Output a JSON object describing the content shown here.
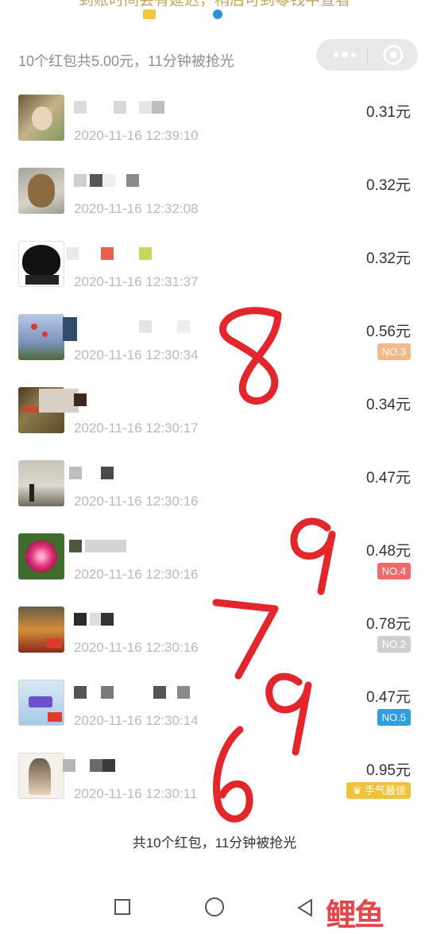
{
  "notice": {
    "text": "到账时间会有延迟，稍后可到零钱中查看"
  },
  "summary": {
    "text": "10个红包共5.00元，11分钟被抢光"
  },
  "capsule": {
    "more_icon": "more-dots-icon",
    "close_icon": "target-icon"
  },
  "records": [
    {
      "time": "2020-11-16 12:39:10",
      "amount": "0.31元",
      "badge": ""
    },
    {
      "time": "2020-11-16 12:32:08",
      "amount": "0.32元",
      "badge": ""
    },
    {
      "time": "2020-11-16 12:31:37",
      "amount": "0.32元",
      "badge": ""
    },
    {
      "time": "2020-11-16 12:30:34",
      "amount": "0.56元",
      "badge": "NO.3"
    },
    {
      "time": "2020-11-16 12:30:17",
      "amount": "0.34元",
      "badge": ""
    },
    {
      "time": "2020-11-16 12:30:16",
      "amount": "0.47元",
      "badge": ""
    },
    {
      "time": "2020-11-16 12:30:16",
      "amount": "0.48元",
      "badge": "NO.4"
    },
    {
      "time": "2020-11-16 12:30:16",
      "amount": "0.78元",
      "badge": "NO.2"
    },
    {
      "time": "2020-11-16 12:30:14",
      "amount": "0.47元",
      "badge": "NO.5"
    },
    {
      "time": "2020-11-16 12:30:11",
      "amount": "0.95元",
      "badge": "手气最佳"
    }
  ],
  "footer": {
    "text": "共10个红包，11分钟被抢光"
  },
  "annotations": {
    "handwritten": [
      "8",
      "9",
      "7",
      "9",
      "6"
    ]
  },
  "watermark": {
    "text": "鲤鱼"
  },
  "colors": {
    "badge_no3": "#f4b98a",
    "badge_no4": "#ef6b6b",
    "badge_no2": "#cfcfcf",
    "badge_no5": "#2e9fe6",
    "badge_best": "#f3c23c",
    "scribble": "#e3262b"
  }
}
